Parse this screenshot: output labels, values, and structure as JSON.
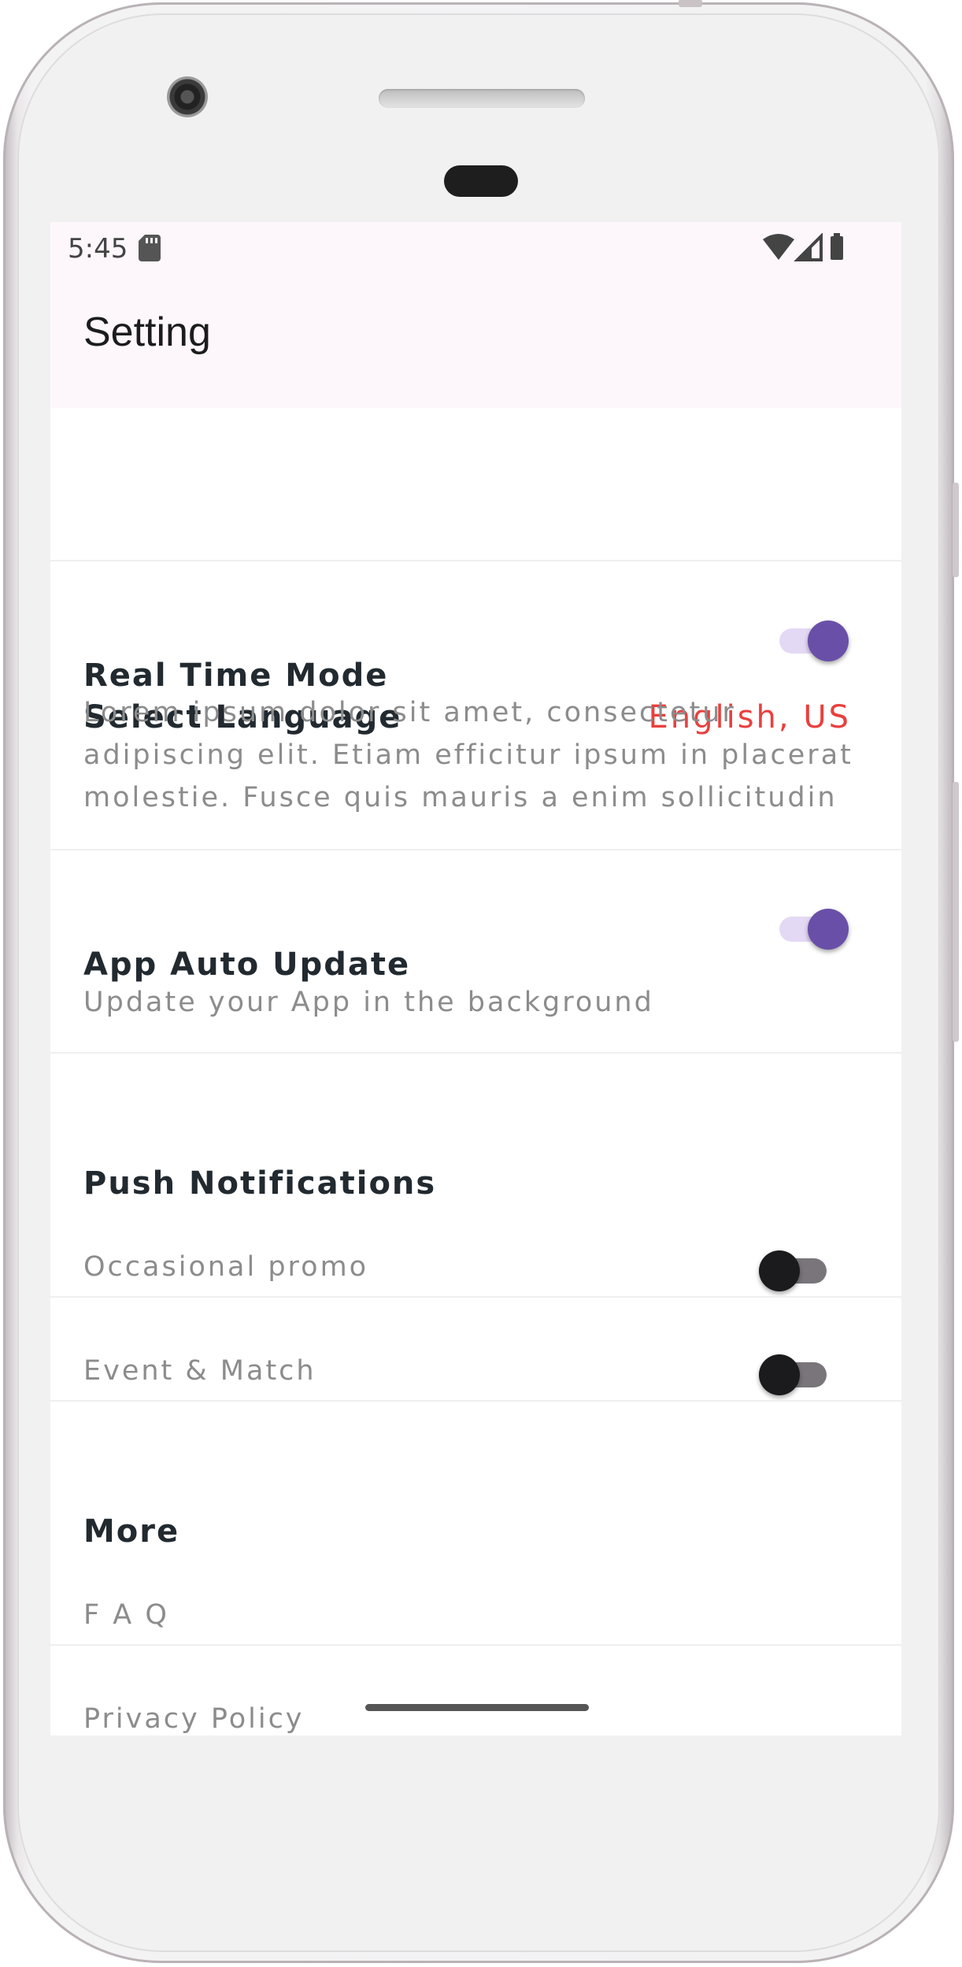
{
  "status_bar": {
    "time": "5:45",
    "icons": [
      "sd-card-icon",
      "wifi-icon",
      "signal-icon",
      "battery-icon"
    ]
  },
  "app_bar": {
    "title": "Setting"
  },
  "language": {
    "label": "Select Language",
    "value": "English, US"
  },
  "real_time_mode": {
    "label": "Real Time Mode",
    "description": "Lorem ipsum dolor sit amet, consectetur adipiscing elit. Etiam efficitur ipsum in placerat molestie. Fusce quis mauris a enim sollicitudin",
    "enabled": true
  },
  "auto_update": {
    "label": "App Auto Update",
    "description": "Update your App in the background",
    "enabled": true
  },
  "push_notifications": {
    "header": "Push Notifications",
    "items": [
      {
        "label": "Occasional promo",
        "enabled": false
      },
      {
        "label": "Event & Match",
        "enabled": false
      }
    ]
  },
  "more": {
    "header": "More",
    "items": [
      {
        "label": "F A Q"
      },
      {
        "label": "Privacy Policy"
      }
    ]
  },
  "colors": {
    "accent": "#6a4fa8",
    "language_value": "#e9403e",
    "app_bar_bg": "#fdf7fb"
  }
}
